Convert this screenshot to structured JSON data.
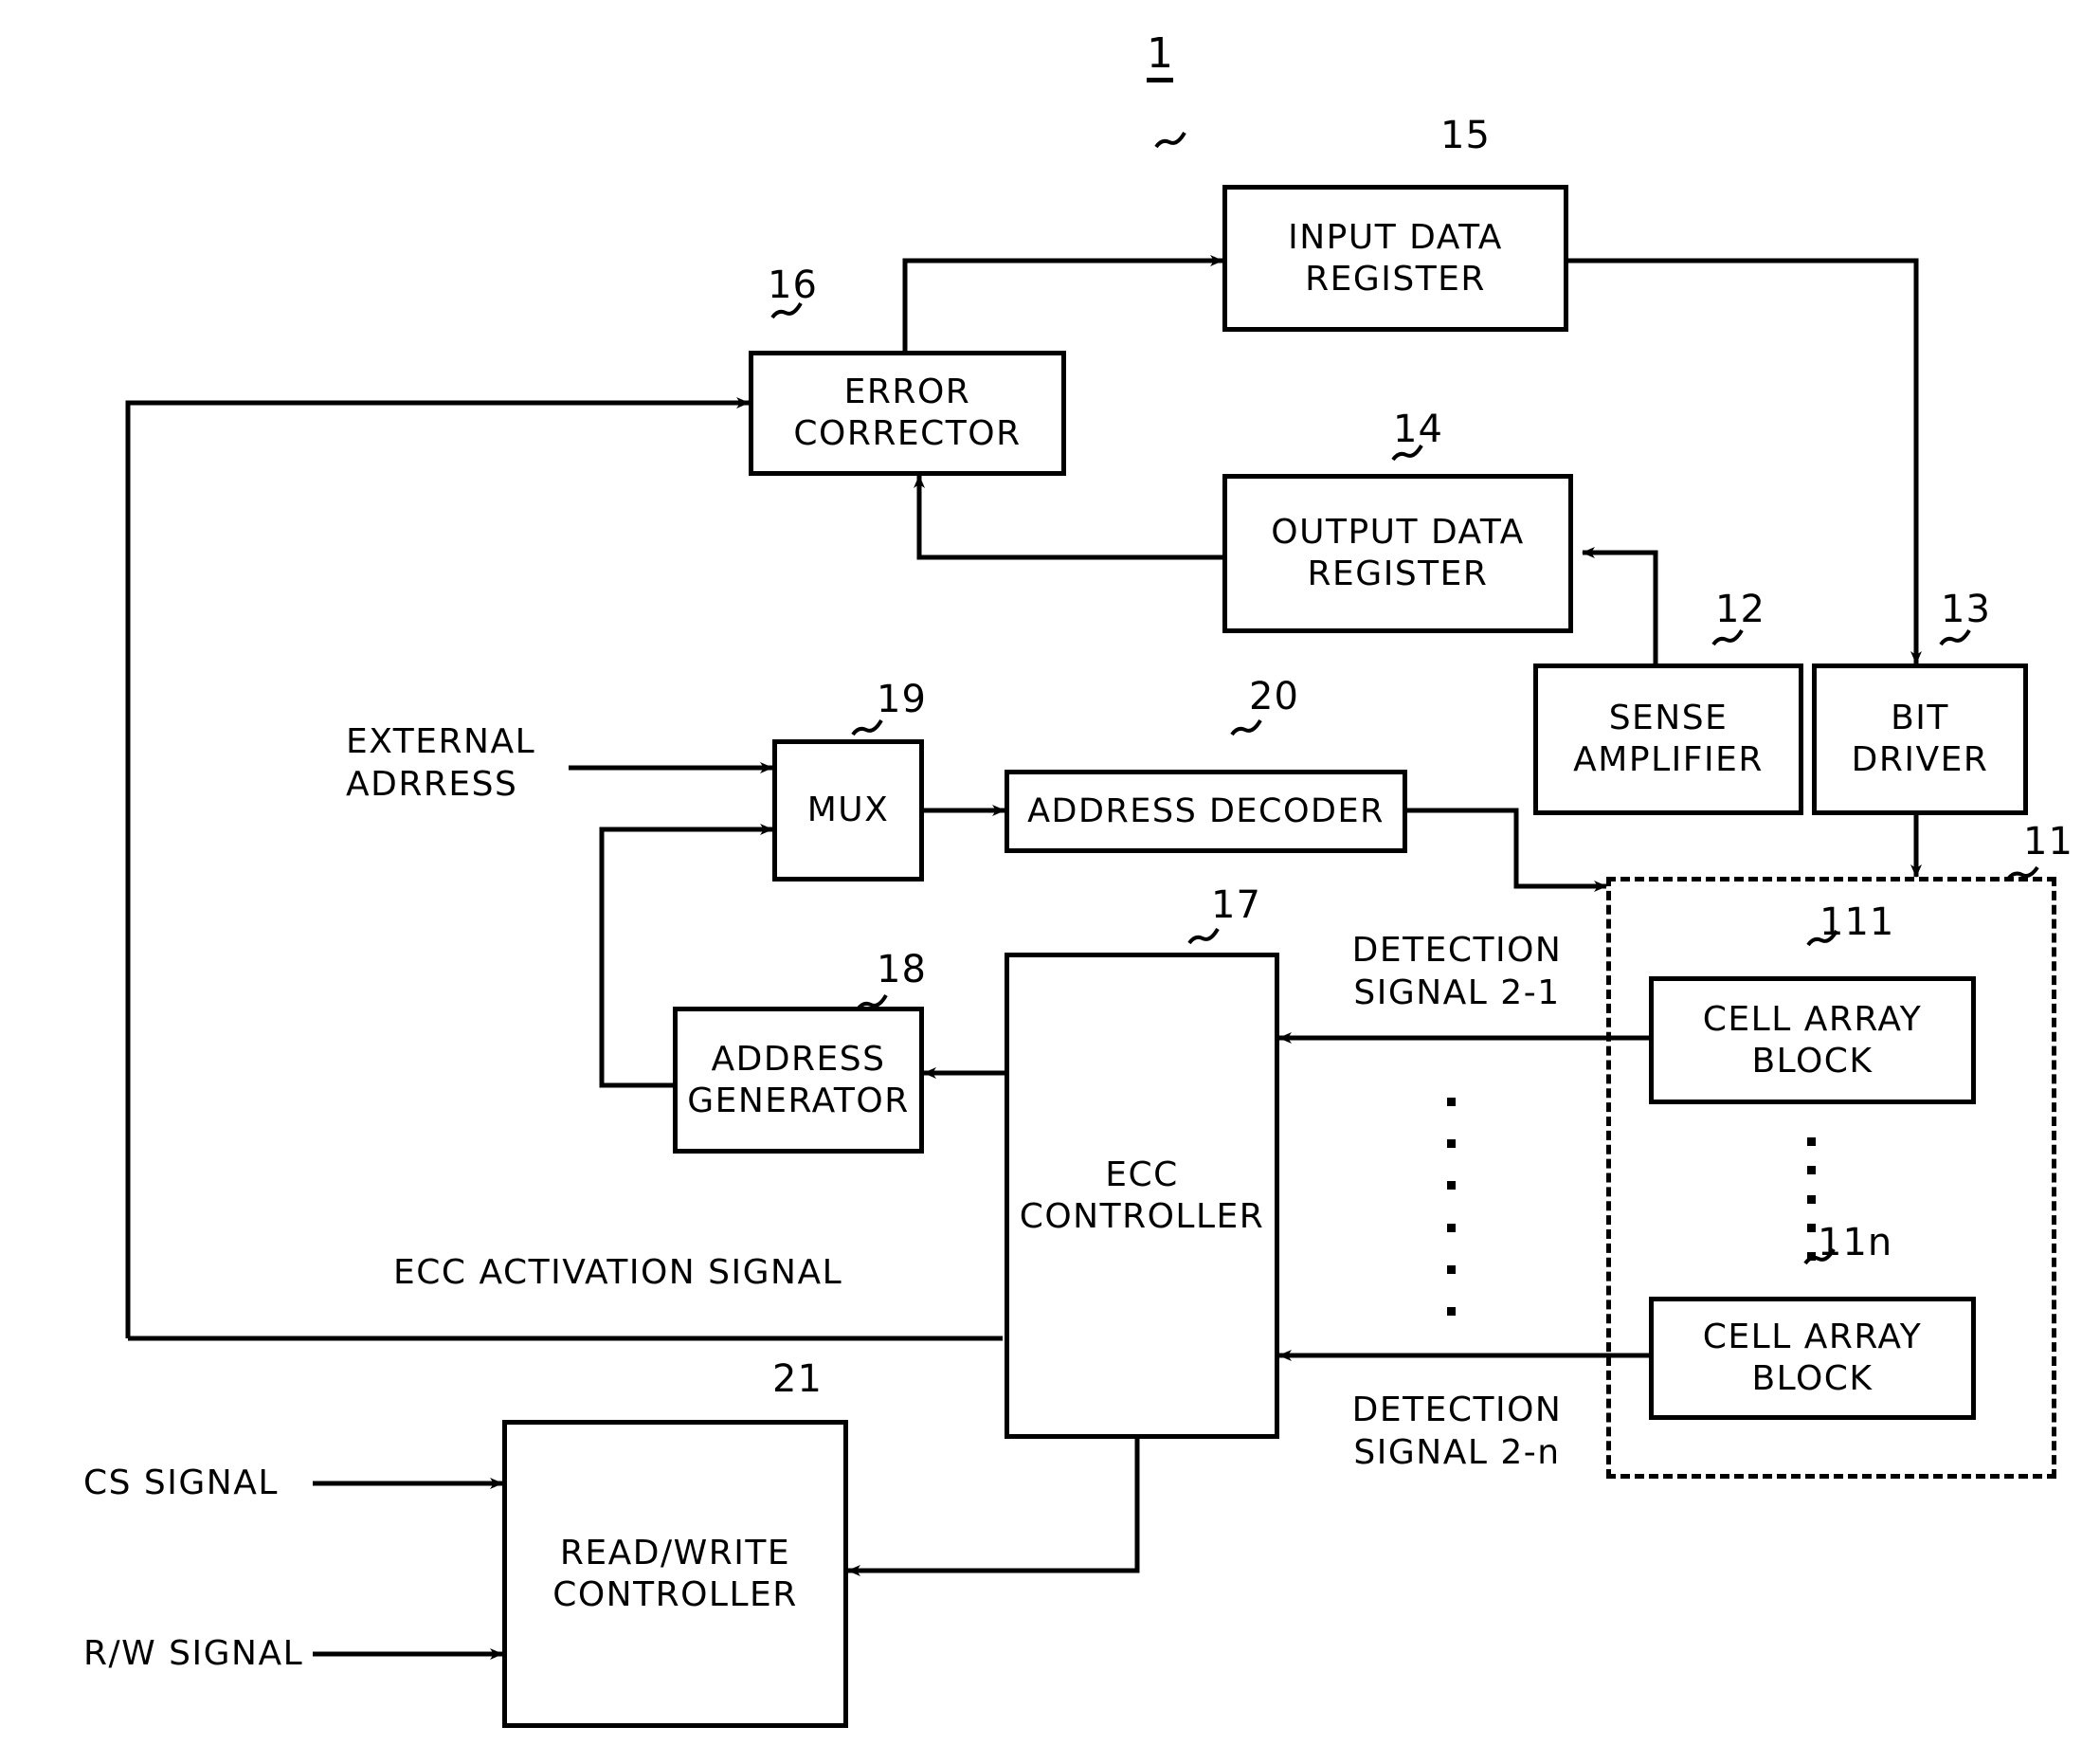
{
  "figure": {
    "number": "1"
  },
  "blocks": [
    {
      "id": "input_data_register",
      "label": "INPUT DATA\nREGISTER",
      "ref": "15"
    },
    {
      "id": "error_corrector",
      "label": "ERROR\nCORRECTOR",
      "ref": "16"
    },
    {
      "id": "output_data_register",
      "label": "OUTPUT DATA\nREGISTER",
      "ref": "14"
    },
    {
      "id": "sense_amplifier",
      "label": "SENSE\nAMPLIFIER",
      "ref": "12"
    },
    {
      "id": "bit_driver",
      "label": "BIT\nDRIVER",
      "ref": "13"
    },
    {
      "id": "mux",
      "label": "MUX",
      "ref": "19"
    },
    {
      "id": "address_decoder",
      "label": "ADDRESS DECODER",
      "ref": "20"
    },
    {
      "id": "address_generator",
      "label": "ADDRESS\nGENERATOR",
      "ref": "18"
    },
    {
      "id": "ecc_controller",
      "label": "ECC\nCONTROLLER",
      "ref": "17"
    },
    {
      "id": "read_write_controller",
      "label": "READ/WRITE\nCONTROLLER",
      "ref": "21"
    },
    {
      "id": "cell_array_block_1",
      "label": "CELL ARRAY\nBLOCK",
      "ref": "111"
    },
    {
      "id": "cell_array_block_n",
      "label": "CELL ARRAY\nBLOCK",
      "ref": "11n"
    }
  ],
  "memory_region": {
    "ref": "11"
  },
  "signals": {
    "external_address": "EXTERNAL\nADRRESS",
    "ecc_activation": "ECC ACTIVATION SIGNAL",
    "detection_signal_1": "DETECTION\nSIGNAL 2-1",
    "detection_signal_n": "DETECTION\nSIGNAL 2-n",
    "cs_signal": "CS SIGNAL",
    "rw_signal": "R/W SIGNAL"
  },
  "colors": {
    "line": "#000000",
    "background": "#ffffff"
  }
}
